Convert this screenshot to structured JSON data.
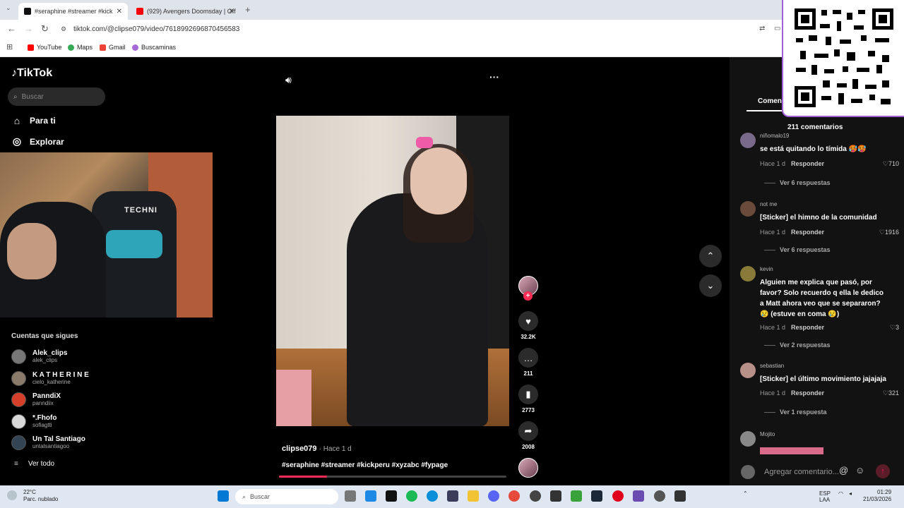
{
  "browser": {
    "tabs": [
      {
        "label": "#seraphine #streamer #kick",
        "active": true,
        "color": "#111111"
      },
      {
        "label": "(929) Avengers Doomsday | Off",
        "active": false,
        "color": "#ff0000"
      }
    ],
    "url": "tiktok.com/@clipse079/video/7618992696870456583",
    "bookmarks": [
      {
        "label": "YouTube",
        "color": "#ff0000"
      },
      {
        "label": "Maps",
        "color": "#34a853"
      },
      {
        "label": "Gmail",
        "color": "#ea4335"
      },
      {
        "label": "Buscaminas",
        "color": "#a66ad8"
      }
    ]
  },
  "app": {
    "logo": "TikTok",
    "search_placeholder": "Buscar",
    "nav": [
      {
        "label": "Para ti",
        "icon": "home-icon"
      },
      {
        "label": "Explorar",
        "icon": "compass-icon"
      }
    ],
    "webcam_brand": "TECHNI",
    "following_title": "Cuentas que sigues",
    "following": [
      {
        "name": "Alek_clips",
        "handle": "alek_clips",
        "color": "#777777"
      },
      {
        "name": "K A T H E R I N E",
        "handle": "cielo_katherine",
        "color": "#8a7a6a"
      },
      {
        "name": "PanndiX",
        "handle": "panndiix",
        "color": "#d6402a"
      },
      {
        "name": "*.Fhofo",
        "handle": "sofiagtti",
        "color": "#d9d9d9"
      },
      {
        "name": "Un Tal Santiago",
        "handle": "untalsantiagoo",
        "color": "#334455"
      }
    ],
    "see_all": "Ver todo"
  },
  "video": {
    "username": "clipse079",
    "time": "· Hace 1 d",
    "hashtags": "#seraphine #streamer #kickperu #xyzabc #fypage",
    "progress": 0.21,
    "likes": "32.2K",
    "comments": "211",
    "saves": "2773",
    "shares": "2008"
  },
  "comments": {
    "tab_label": "Comen",
    "count": "211 comentarios",
    "items": [
      {
        "user": "niñomalo19",
        "text": "se está quitando lo tímida 🥵🥵",
        "time": "Hace 1 d",
        "reply": "Responder",
        "likes": "710",
        "replies": "Ver 6 respuestas",
        "color": "#7a6a8a"
      },
      {
        "user": "not me",
        "text": "[Sticker] el himno de la comunidad",
        "time": "Hace 1 d",
        "reply": "Responder",
        "likes": "1916",
        "replies": "Ver 6 respuestas",
        "color": "#6a4a3a"
      },
      {
        "user": "kevin",
        "text": "Alguien me explica que pasó, por favor? Solo recuerdo q ella le dedico a Matt ahora veo que se separaron? 😢 (estuve en coma 😢)",
        "time": "Hace 1 d",
        "reply": "Responder",
        "likes": "3",
        "replies": "Ver 2 respuestas",
        "color": "#8a7a3a"
      },
      {
        "user": "sebastian",
        "text": "[Sticker] el último movimiento jajajaja",
        "time": "Hace 1 d",
        "reply": "Responder",
        "likes": "321",
        "replies": "Ver 1 respuesta",
        "color": "#b8908a"
      },
      {
        "user": "Mojito",
        "text": "",
        "time": "",
        "reply": "",
        "likes": "",
        "replies": "",
        "color": "#888888"
      }
    ],
    "add_placeholder": "Agregar comentario..."
  },
  "taskbar": {
    "temp": "22°C",
    "weather": "Parc. nublado",
    "search": "Buscar",
    "lang": "ESP",
    "lang2": "LAA",
    "time": "01:29",
    "date": "21/03/2026"
  }
}
